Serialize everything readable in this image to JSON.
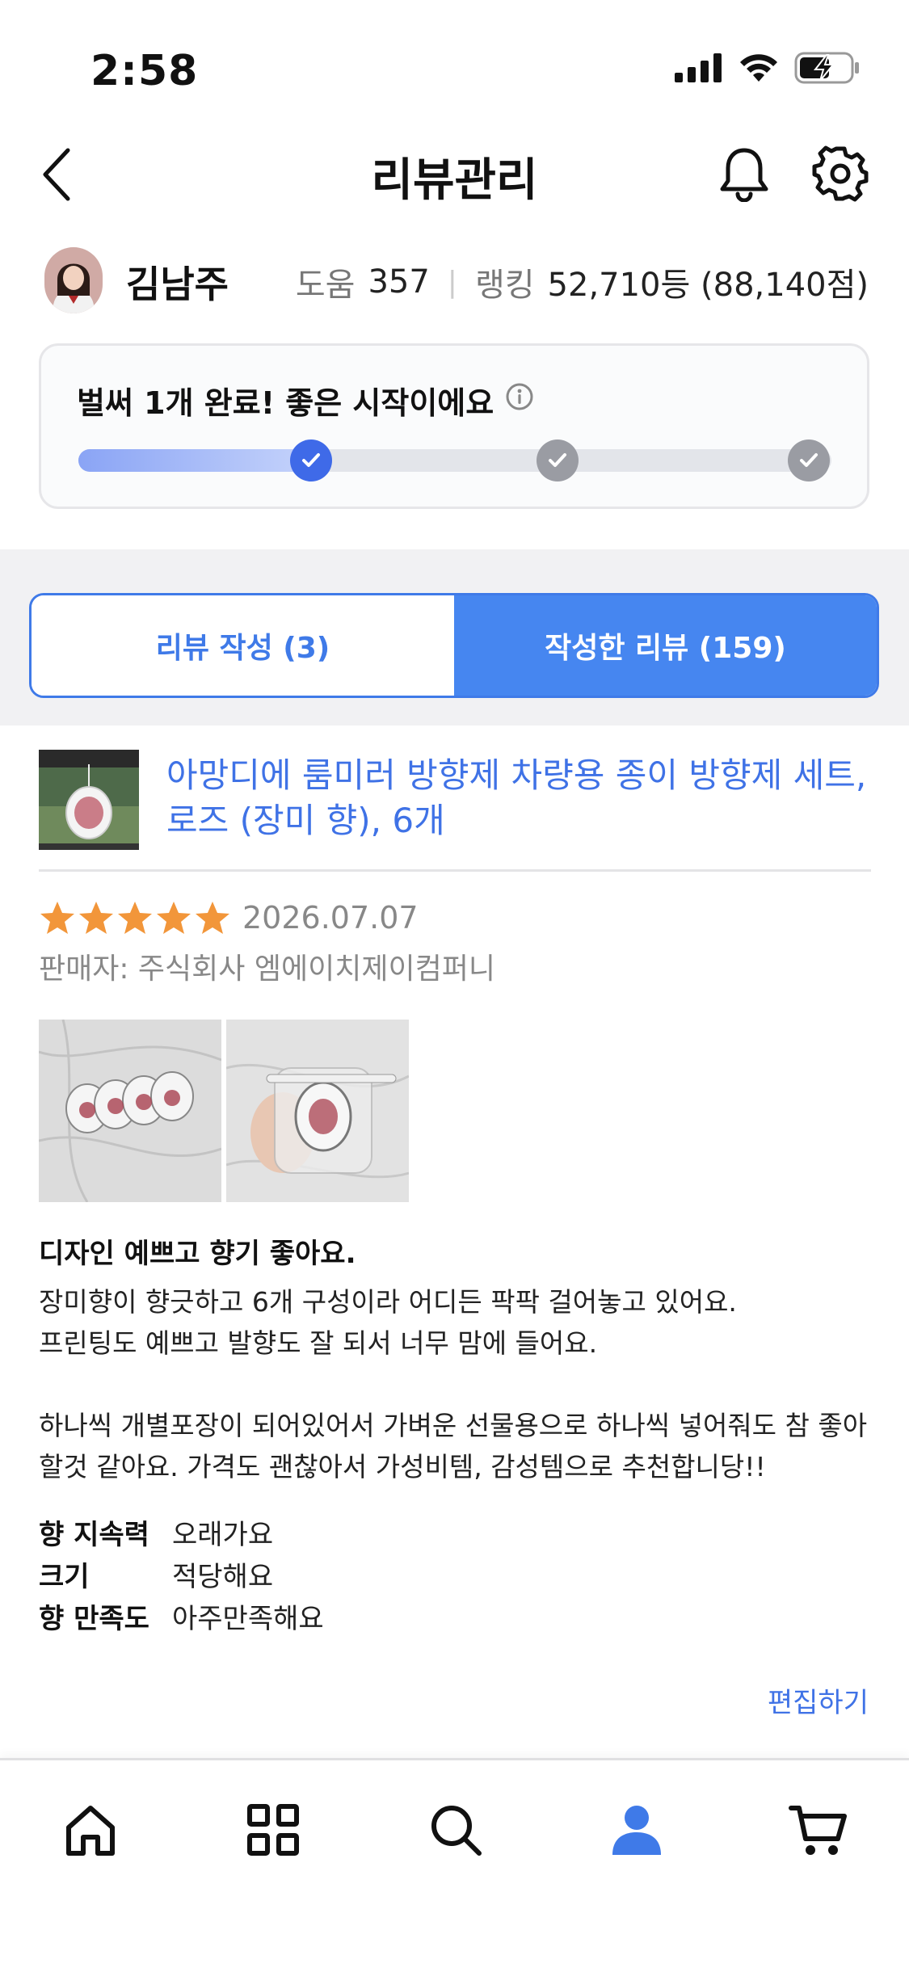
{
  "status_bar": {
    "time": "2:58"
  },
  "header": {
    "title": "리뷰관리"
  },
  "profile": {
    "name": "김남주",
    "help_label": "도움",
    "help_count": "357",
    "rank_label": "랭킹",
    "rank_value": "52,710등 (88,140점)"
  },
  "progress": {
    "message": "벌써 1개 완료! 좋은 시작이에요",
    "completed_steps": 1,
    "total_steps": 3,
    "fill_fraction": 0.33
  },
  "tabs": {
    "write": "리뷰 작성 (3)",
    "written": "작성한 리뷰 (159)",
    "active": "written"
  },
  "product": {
    "name": "아망디에 룸미러 방향제 차량용 종이 방향제 세트, 로즈 (장미 향), 6개"
  },
  "review": {
    "rating": 5,
    "date": "2026.07.07",
    "seller": "판매자: 주식회사 엠에이치제이컴퍼니",
    "headline": "디자인 예쁘고 향기 좋아요.",
    "body_line1": "장미향이 향긋하고 6개 구성이라 어디든 팍팍 걸어놓고 있어요.",
    "body_line2": "프린팅도 예쁘고 발향도 잘 되서 너무 맘에 들어요.",
    "body_line3": "하나씩 개별포장이 되어있어서 가벼운 선물용으로 하나씩 넣어줘도 참 좋아할것 같아요. 가격도 괜찮아서 가성비템, 감성템으로 추천합니당!!",
    "attributes": [
      {
        "key": "향 지속력",
        "value": "오래가요"
      },
      {
        "key": "크기",
        "value": "적당해요"
      },
      {
        "key": "향 만족도",
        "value": "아주만족해요"
      }
    ],
    "edit_label": "편집하기"
  },
  "colors": {
    "accent": "#3f7ae8",
    "star": "#f2963a",
    "link": "#3f72e6"
  },
  "bottom_nav": [
    "home-icon",
    "grid-icon",
    "search-icon",
    "person-icon",
    "cart-icon"
  ]
}
